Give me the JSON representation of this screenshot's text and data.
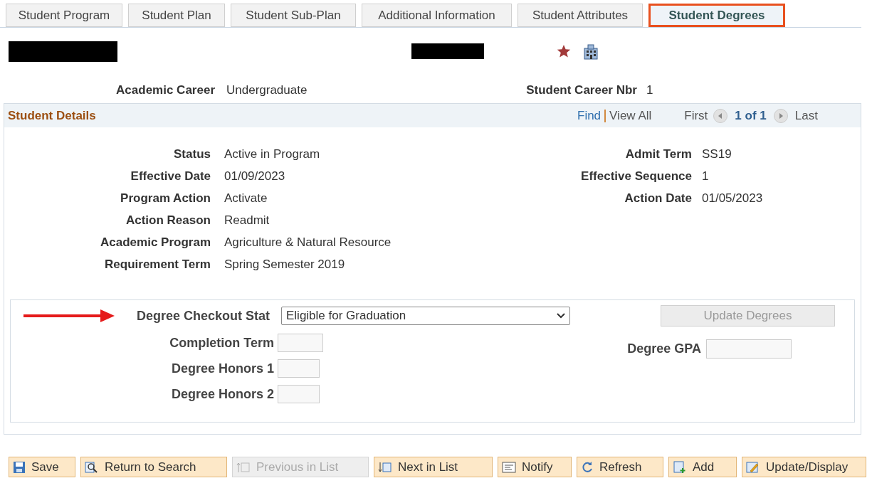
{
  "tabs": [
    {
      "label": "Student Program",
      "selected": false
    },
    {
      "label": "Student Plan",
      "selected": false
    },
    {
      "label": "Student Sub-Plan",
      "selected": false
    },
    {
      "label": "Additional Information",
      "selected": false
    },
    {
      "label": "Student Attributes",
      "selected": false
    },
    {
      "label": "Student Degrees",
      "selected": true
    }
  ],
  "career": {
    "label": "Academic Career",
    "value": "Undergraduate",
    "nbr_label": "Student Career Nbr",
    "nbr_value": "1"
  },
  "panel": {
    "title": "Student Details",
    "find": "Find",
    "view_all": "View All",
    "first": "First",
    "count": "1 of 1",
    "last": "Last",
    "left_fields": [
      {
        "label": "Status",
        "value": "Active in Program"
      },
      {
        "label": "Effective Date",
        "value": "01/09/2023"
      },
      {
        "label": "Program Action",
        "value": "Activate"
      },
      {
        "label": "Action Reason",
        "value": "Readmit"
      },
      {
        "label": "Academic Program",
        "value": "Agriculture & Natural Resource"
      },
      {
        "label": "Requirement Term",
        "value": "Spring Semester 2019"
      }
    ],
    "right_fields": [
      {
        "label": "Admit Term",
        "value": "SS19"
      },
      {
        "label": "Effective Sequence",
        "value": "1"
      },
      {
        "label": "Action Date",
        "value": "01/05/2023"
      }
    ]
  },
  "degree": {
    "checkout_label": "Degree Checkout Stat",
    "checkout_value": "Eligible for Graduation",
    "update_button": "Update Degrees",
    "update_disabled": true,
    "completion_label": "Completion Term",
    "honors1_label": "Degree Honors 1",
    "honors2_label": "Degree Honors 2",
    "gpa_label": "Degree GPA"
  },
  "toolbar": [
    {
      "label": "Save",
      "kind": "save",
      "disabled": false
    },
    {
      "label": "Return to Search",
      "kind": "search",
      "disabled": false
    },
    {
      "label": "Previous in List",
      "kind": "previous",
      "disabled": true
    },
    {
      "label": "Next in List",
      "kind": "next",
      "disabled": false
    },
    {
      "label": "Notify",
      "kind": "notify",
      "disabled": false
    },
    {
      "label": "Refresh",
      "kind": "refresh",
      "disabled": false
    },
    {
      "label": "Add",
      "kind": "add",
      "disabled": false
    },
    {
      "label": "Update/Display",
      "kind": "update",
      "disabled": false
    }
  ]
}
